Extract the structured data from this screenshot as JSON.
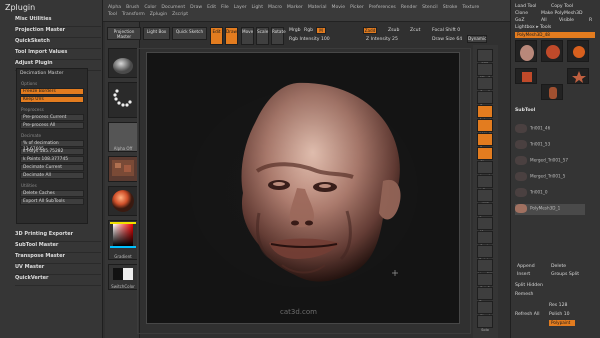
{
  "menubar": {
    "items": [
      "Alpha",
      "Brush",
      "Color",
      "Document",
      "Draw",
      "Edit",
      "File",
      "Layer",
      "Light",
      "Macro",
      "Marker",
      "Material",
      "Movie",
      "Picker",
      "Preferences",
      "Render",
      "Stencil",
      "Stroke",
      "Texture",
      "Tool",
      "Transform",
      "Zplugin",
      "Zscript"
    ],
    "top_right": [
      "Menus",
      "DefaultZScript"
    ]
  },
  "left_panel": {
    "title": "Zplugin",
    "items": [
      "Misc Utilities",
      "Projection Master",
      "QuickSketch",
      "Tool Import Values",
      "Adjust Plugin"
    ],
    "decimation": {
      "title": "Decimation Master",
      "options_label": "Options",
      "btn_freeze": "Freeze Borders",
      "btn_keep": "Keep UVs",
      "preprocess_label": "Preprocess",
      "btn_pre_current": "Pre-process Current",
      "btn_pre_all": "Pre-process All",
      "decimate_label": "Decimate",
      "pct": "% of decimation 12.67605",
      "kpolys": "k Polys 185.75282",
      "kpoints": "k Points 108.377745",
      "btn_dec_current": "Decimate Current",
      "btn_dec_all": "Decimate All",
      "utilities_label": "Utilities",
      "btn_delete_caches": "Delete Caches",
      "btn_export": "Export All SubTools"
    },
    "items2": [
      "3D Printing Exporter",
      "SubTool Master",
      "Transpose Master",
      "UV Master",
      "QuickVerter"
    ]
  },
  "tool_strip": {
    "items": [
      "",
      "",
      "",
      "Alpha Off",
      "",
      "Texture Off",
      "",
      "Gradient",
      "SwitchColor"
    ]
  },
  "toolbar": {
    "projection_master": "Projection Master",
    "lightbox": "Light Box",
    "quick_sketch": "Quick Sketch",
    "edit": "Edit",
    "draw": "Draw",
    "move": "Move",
    "scale": "Scale",
    "rotate": "Rotate",
    "mrgb": "Mrgb",
    "rgb": "Rgb",
    "m": "M",
    "zadd": "Zadd",
    "zsub": "Zsub",
    "zcut": "Zcut",
    "rgb_intensity": "Rgb Intensity 100",
    "z_intensity": "Z Intensity 25",
    "focal_shift": "Focal Shift 0",
    "draw_size": "Draw Size 64",
    "dynamic": "Dynamic"
  },
  "canvas": {
    "watermark": "cat3d.com"
  },
  "right_strip": {
    "items": [
      "BPR",
      "SPix 3",
      "Scroll",
      "Zoom",
      "Actual",
      "AAHalf",
      "Persp",
      "Floor",
      "Local",
      "L.Sym",
      "XYZ",
      "Frame",
      "Move",
      "Scale",
      "Rotate",
      "Line Fill",
      "PolyF",
      "Transp",
      "Ghost",
      "Solo",
      "Xpose",
      "Dyn"
    ]
  },
  "right_panel": {
    "load": "Load Tool",
    "copy": "Copy Tool",
    "clone": "Clone",
    "make_polymesh": "Make PolyMesh3D",
    "goz": "GoZ",
    "all": "All",
    "visible": "Visible",
    "r": "R",
    "lightbox_tools": "Lightbox ▸ Tools",
    "tool_name": "PolyMesh3D_48",
    "thumbs": [
      "PolyMesh3D",
      "Sphere3D",
      "SimpleBrush",
      "Cube3D",
      "Cylinder3D",
      "PolyMesh3D_1"
    ],
    "subtool_title": "SubTool",
    "subtools": [
      "Tri001_46",
      "Tri001_53",
      "Merged_Tri001_57",
      "Merged_Tri001_5",
      "Tri001_0",
      "PolyMesh3D_1"
    ],
    "append": "Append",
    "insert": "Insert",
    "delete": "Delete",
    "duplicate": "Duplicate",
    "groups_split": "Groups Split",
    "split_hidden": "Split Hidden",
    "remesh": "Remesh",
    "rename": "Rename",
    "autoreorder": "AutoReorder",
    "refresh_all": "Refresh All",
    "polish": "Polish 10",
    "sharp": "Sharp",
    "res": "Res 128",
    "polypaint": "Polypaint",
    "subtool_master": "SubTool Master"
  }
}
